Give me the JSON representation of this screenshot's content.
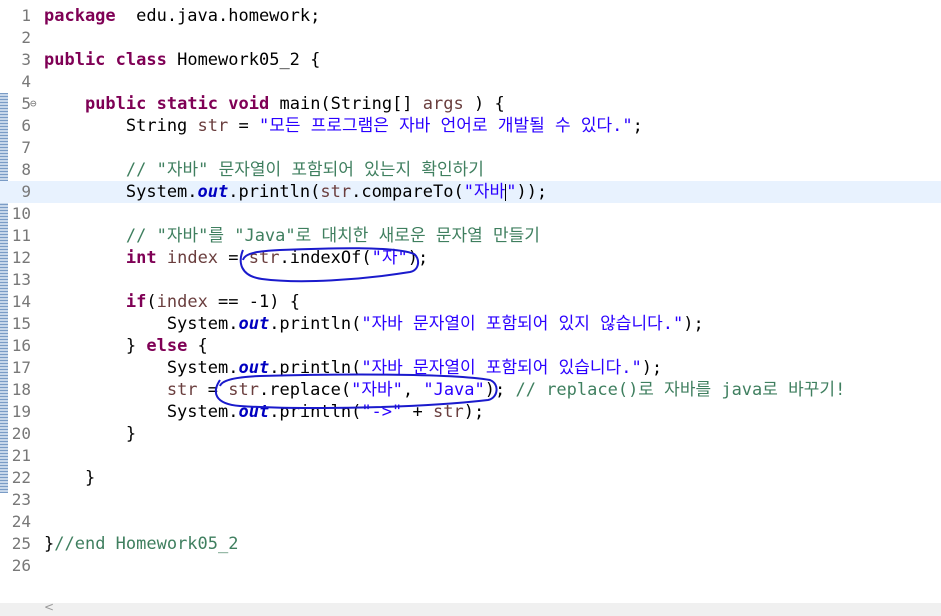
{
  "editor": {
    "lines": [
      {
        "n": "1",
        "parts": [
          [
            "kw",
            "package"
          ],
          [
            "",
            "  edu.java.homework;"
          ]
        ]
      },
      {
        "n": "2",
        "parts": []
      },
      {
        "n": "3",
        "parts": [
          [
            "kw",
            "public"
          ],
          [
            "",
            " "
          ],
          [
            "kw",
            "class"
          ],
          [
            "",
            " Homework05_2 {"
          ]
        ]
      },
      {
        "n": "4",
        "parts": []
      },
      {
        "n": "5",
        "fold": true,
        "parts": [
          [
            "",
            "    "
          ],
          [
            "kw",
            "public"
          ],
          [
            "",
            " "
          ],
          [
            "kw",
            "static"
          ],
          [
            "",
            " "
          ],
          [
            "kw",
            "void"
          ],
          [
            "",
            " main(String[] "
          ],
          [
            "var",
            "args"
          ],
          [
            "",
            " ) {"
          ]
        ]
      },
      {
        "n": "6",
        "parts": [
          [
            "",
            "        String "
          ],
          [
            "var",
            "str"
          ],
          [
            "",
            " = "
          ],
          [
            "str",
            "\"모든 프로그램은 자바 언어로 개발될 수 있다.\""
          ],
          [
            "",
            ";"
          ]
        ]
      },
      {
        "n": "7",
        "parts": []
      },
      {
        "n": "8",
        "parts": [
          [
            "",
            "        "
          ],
          [
            "cm",
            "// \"자바\" 문자열이 포함되어 있는지 확인하기"
          ]
        ]
      },
      {
        "n": "9",
        "current": true,
        "parts": [
          [
            "",
            "        System."
          ],
          [
            "fld",
            "out"
          ],
          [
            "",
            ".println("
          ],
          [
            "var",
            "str"
          ],
          [
            "",
            ".compareTo("
          ],
          [
            "str",
            "\"자바"
          ],
          [
            "caret",
            ""
          ],
          [
            "str",
            "\""
          ],
          [
            "",
            "));"
          ]
        ]
      },
      {
        "n": "10",
        "parts": []
      },
      {
        "n": "11",
        "parts": [
          [
            "",
            "        "
          ],
          [
            "cm",
            "// \"자바\"를 \"Java\"로 대치한 새로운 문자열 만들기"
          ]
        ]
      },
      {
        "n": "12",
        "parts": [
          [
            "",
            "        "
          ],
          [
            "kw",
            "int"
          ],
          [
            "",
            " "
          ],
          [
            "var",
            "index"
          ],
          [
            "",
            " = "
          ],
          [
            "var",
            "str"
          ],
          [
            "",
            ".indexOf("
          ],
          [
            "str",
            "\"자\""
          ],
          [
            "",
            ");"
          ]
        ]
      },
      {
        "n": "13",
        "parts": []
      },
      {
        "n": "14",
        "parts": [
          [
            "",
            "        "
          ],
          [
            "kw",
            "if"
          ],
          [
            "",
            "("
          ],
          [
            "var",
            "index"
          ],
          [
            "",
            " == -1) {"
          ]
        ]
      },
      {
        "n": "15",
        "parts": [
          [
            "",
            "            System."
          ],
          [
            "fld",
            "out"
          ],
          [
            "",
            ".println("
          ],
          [
            "str",
            "\"자바 문자열이 포함되어 있지 않습니다.\""
          ],
          [
            "",
            ");"
          ]
        ]
      },
      {
        "n": "16",
        "parts": [
          [
            "",
            "        } "
          ],
          [
            "kw",
            "else"
          ],
          [
            "",
            " {"
          ]
        ]
      },
      {
        "n": "17",
        "parts": [
          [
            "",
            "            System."
          ],
          [
            "fld",
            "out"
          ],
          [
            "",
            ".println("
          ],
          [
            "str",
            "\"자바 문자열이 포함되어 있습니다.\""
          ],
          [
            "",
            ");"
          ]
        ]
      },
      {
        "n": "18",
        "parts": [
          [
            "",
            "            "
          ],
          [
            "var",
            "str"
          ],
          [
            "",
            " = "
          ],
          [
            "var",
            "str"
          ],
          [
            "",
            ".replace("
          ],
          [
            "str",
            "\"자바\""
          ],
          [
            "",
            ", "
          ],
          [
            "str",
            "\"Java\""
          ],
          [
            "",
            "); "
          ],
          [
            "cm",
            "// replace()로 자바를 java로 바꾸기!"
          ]
        ]
      },
      {
        "n": "19",
        "parts": [
          [
            "",
            "            System."
          ],
          [
            "fld",
            "out"
          ],
          [
            "",
            ".println("
          ],
          [
            "str",
            "\"->\""
          ],
          [
            "",
            " + "
          ],
          [
            "var",
            "str"
          ],
          [
            "",
            ");"
          ]
        ]
      },
      {
        "n": "20",
        "parts": [
          [
            "",
            "        }"
          ]
        ]
      },
      {
        "n": "21",
        "parts": []
      },
      {
        "n": "22",
        "parts": [
          [
            "",
            "    }"
          ]
        ]
      },
      {
        "n": "23",
        "parts": []
      },
      {
        "n": "24",
        "parts": []
      },
      {
        "n": "25",
        "parts": [
          [
            "",
            "}"
          ],
          [
            "cm",
            "//end Homework05_2"
          ]
        ]
      },
      {
        "n": "26",
        "parts": []
      }
    ]
  },
  "scrollbar": {
    "left_arrow": "<"
  },
  "colors": {
    "keyword": "#7f0055",
    "string": "#2a00ff",
    "comment": "#3f7f5f",
    "static_field": "#0000c0",
    "local_variable": "#6a3e3e",
    "current_line_bg": "#e8f2fe",
    "annotation_ink": "#1a1acc"
  }
}
